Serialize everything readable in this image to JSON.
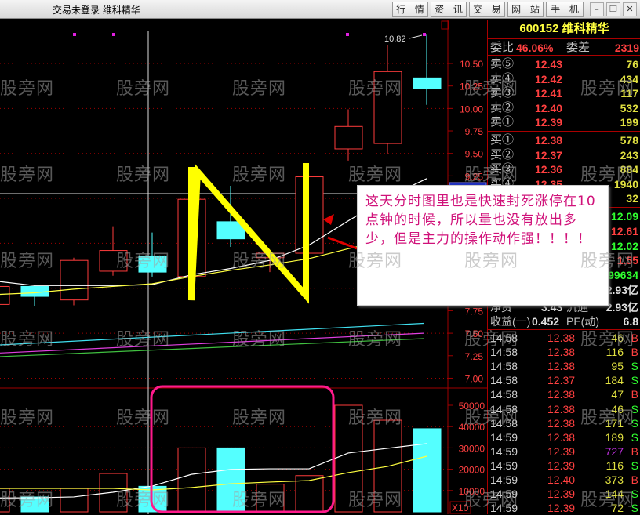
{
  "window": {
    "title": "交易未登录  维科精华",
    "tabs": [
      "行 情",
      "资 讯",
      "交 易",
      "网 站",
      "手 机"
    ],
    "controls": {
      "minimize": "–",
      "restore": "❐",
      "close": "✕"
    }
  },
  "watermark": "股旁网",
  "colors": {
    "up": "#ff3c3c",
    "down": "#54ffff",
    "ma5": "#ffffff",
    "ma10": "#ffff40",
    "ma_long1": "#40e0f0",
    "ma_long2": "#e040e0",
    "ma_long3": "#40c040",
    "grid": "#a00000",
    "axis_text": "#ff4040",
    "annotation": "#d0127a",
    "n_mark": "#ffff00"
  },
  "chart_data": {
    "type": "candlestick",
    "price_axis": {
      "range": [
        7.0,
        10.5
      ],
      "ticks_visible": [
        "10.50",
        "10.25",
        "10.00",
        "9.75",
        "9.50",
        "9.25",
        "7.75",
        "7.50",
        "7.25",
        "7.00"
      ],
      "grid": [
        10.5,
        10.0,
        9.5,
        9.0,
        8.5,
        8.0,
        7.5,
        7.0
      ]
    },
    "high_label": "10.82",
    "candles": [
      {
        "open": 7.82,
        "close": 8.02,
        "high": 8.02,
        "low": 7.82
      },
      {
        "open": 8.02,
        "close": 7.91,
        "high": 8.04,
        "low": 7.8
      },
      {
        "open": 7.87,
        "close": 8.31,
        "high": 8.34,
        "low": 7.81
      },
      {
        "open": 8.19,
        "close": 8.42,
        "high": 8.69,
        "low": 8.14
      },
      {
        "open": 8.36,
        "close": 8.18,
        "high": 8.62,
        "low": 8.13
      },
      {
        "open": 8.13,
        "close": 8.99,
        "high": 8.99,
        "low": 8.13
      },
      {
        "open": 8.74,
        "close": 8.55,
        "high": 9.14,
        "low": 8.46
      },
      {
        "open": 8.34,
        "close": 8.39,
        "high": 8.4,
        "low": 8.18
      },
      {
        "open": 8.39,
        "close": 9.24,
        "high": 9.24,
        "low": 8.39
      },
      {
        "open": 9.55,
        "close": 9.8,
        "high": 9.99,
        "low": 9.42
      },
      {
        "open": 9.61,
        "close": 10.41,
        "high": 10.7,
        "low": 9.49
      },
      {
        "open": 10.34,
        "close": 10.22,
        "high": 10.82,
        "low": 10.04
      }
    ],
    "ma_short": [
      8.08,
      8.03,
      8.03,
      8.03,
      8.04,
      8.15,
      8.22,
      8.31,
      8.48,
      8.75,
      9.01,
      9.22
    ],
    "ma_mid": [
      7.93,
      7.95,
      7.99,
      8.02,
      8.05,
      8.13,
      8.2,
      8.26,
      8.33,
      8.44,
      8.54,
      8.65
    ],
    "ma_long": [
      [
        7.37,
        7.61
      ],
      [
        7.28,
        7.5
      ],
      [
        7.24,
        7.44
      ]
    ],
    "volume_axis": {
      "range": [
        0,
        50000
      ],
      "ticks": [
        "50000",
        "40000",
        "30000",
        "20000",
        "10000"
      ],
      "unit": "X10"
    },
    "volumes": [
      11000,
      7000,
      11000,
      18000,
      12000,
      30000,
      30000,
      13000,
      17000,
      50000,
      43000,
      39000
    ],
    "vol_ma_short": [
      6500,
      6600,
      7000,
      9200,
      12100,
      17600,
      19900,
      20200,
      20200,
      27600,
      29800,
      32000
    ],
    "vol_ma_mid": [
      11000,
      11000,
      11000,
      11000,
      10300,
      11400,
      13200,
      14000,
      14700,
      18400,
      21300,
      26100
    ]
  },
  "annotation": "这天分时图里也是快速封死涨停在10点钟的时候，所以量也没有放出多少，但是主力的操作动作强！！！！",
  "quote": {
    "header": "600152 维科精华",
    "weibi_label": "委比",
    "weibi": "46.06%",
    "weicha_label": "委差",
    "weicha": "2319",
    "asks": [
      {
        "label": "卖⑤",
        "price": "12.43",
        "vol": "76"
      },
      {
        "label": "卖④",
        "price": "12.42",
        "vol": "434"
      },
      {
        "label": "卖③",
        "price": "12.41",
        "vol": "117"
      },
      {
        "label": "卖②",
        "price": "12.40",
        "vol": "532"
      },
      {
        "label": "卖①",
        "price": "12.39",
        "vol": "199"
      }
    ],
    "bids": [
      {
        "label": "买①",
        "price": "12.38",
        "vol": "578"
      },
      {
        "label": "买②",
        "price": "12.37",
        "vol": "243"
      },
      {
        "label": "买③",
        "price": "12.36",
        "vol": "884"
      },
      {
        "label": "买④",
        "price": "12.35",
        "vol": "1940"
      },
      {
        "label": "",
        "price": "",
        "vol": "32"
      }
    ],
    "stats": [
      {
        "value": "12.09",
        "color": "#30ff30"
      },
      {
        "value": "12.61",
        "color": "#ff4040"
      },
      {
        "value": "12.02",
        "color": "#30ff30"
      },
      {
        "value": "1.55",
        "color": "#ff4040"
      },
      {
        "value": "99634",
        "color": "#30ff30"
      },
      {
        "value": "2.93亿",
        "color": "#e0e0e0"
      }
    ],
    "jingzi_label": "净资",
    "jingzi": "3.43",
    "liutong_label": "流通",
    "liutong": "2.93亿",
    "shouyi_label": "收益(一)",
    "shouyi": "0.452",
    "pe_label": "PE(动)",
    "pe": "6.8",
    "ticks": [
      {
        "time": "14:58",
        "price": "12.38",
        "vol": "46",
        "side": "B"
      },
      {
        "time": "14:58",
        "price": "12.38",
        "vol": "116",
        "side": "B"
      },
      {
        "time": "14:58",
        "price": "12.38",
        "vol": "95",
        "side": "S"
      },
      {
        "time": "14:58",
        "price": "12.37",
        "vol": "184",
        "side": "S"
      },
      {
        "time": "14:58",
        "price": "12.38",
        "vol": "47",
        "side": "B"
      },
      {
        "time": "14:58",
        "price": "12.38",
        "vol": "46",
        "side": "S"
      },
      {
        "time": "14:58",
        "price": "12.38",
        "vol": "171",
        "side": "S"
      },
      {
        "time": "14:59",
        "price": "12.38",
        "vol": "189",
        "side": "S"
      },
      {
        "time": "14:59",
        "price": "12.39",
        "vol": "727",
        "side": "B",
        "big": true
      },
      {
        "time": "14:59",
        "price": "12.39",
        "vol": "116",
        "side": "S"
      },
      {
        "time": "14:59",
        "price": "12.40",
        "vol": "373",
        "side": "B"
      },
      {
        "time": "14:59",
        "price": "12.39",
        "vol": "144",
        "side": "S"
      },
      {
        "time": "14:59",
        "price": "12.39",
        "vol": "72",
        "side": "S"
      }
    ]
  }
}
